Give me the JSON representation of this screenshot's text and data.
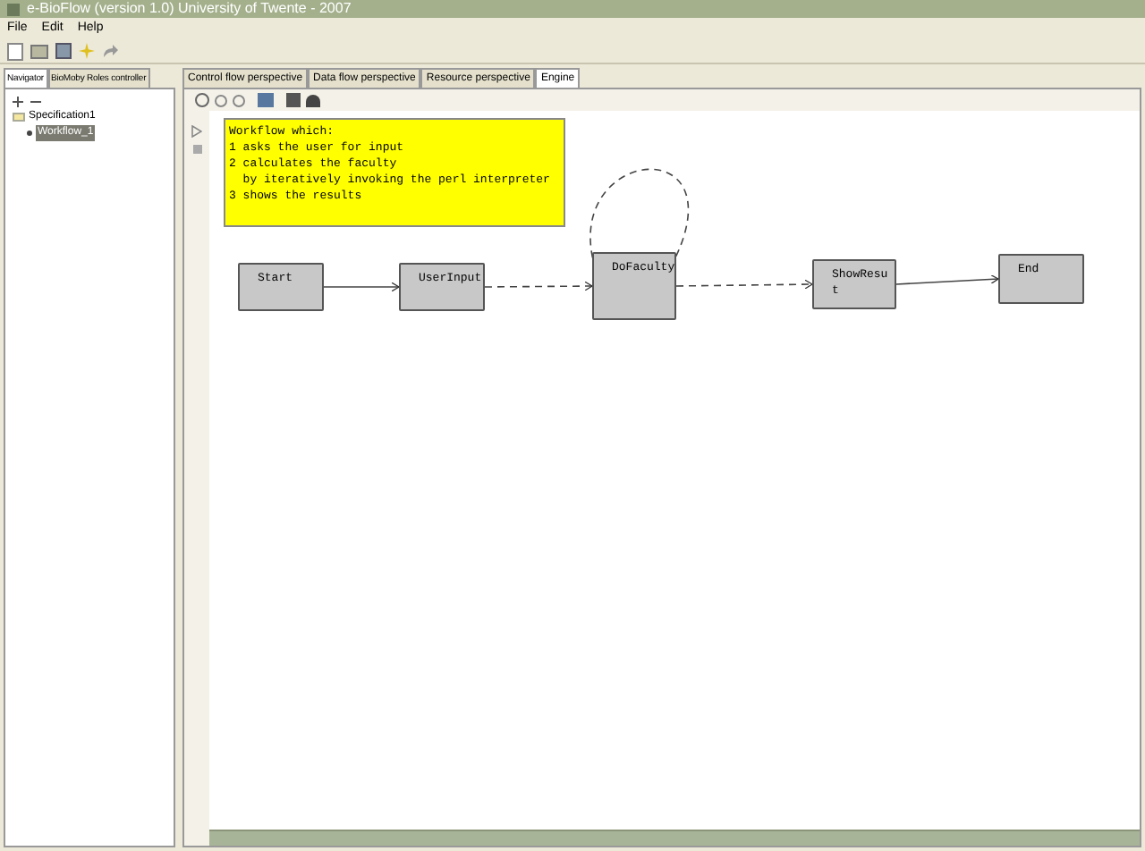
{
  "window": {
    "title": "e-BioFlow (version 1.0) University of Twente - 2007"
  },
  "menu": [
    "File",
    "Edit",
    "Help"
  ],
  "left_tabs": [
    {
      "label": "Navigator",
      "selected": true
    },
    {
      "label": "BioMoby Roles controller",
      "selected": false
    }
  ],
  "tree": [
    {
      "label": "Specification1",
      "expanded": true,
      "children": [
        {
          "label": "Workflow_1",
          "selected": true
        }
      ]
    }
  ],
  "tabs": [
    {
      "label": "Control flow perspective",
      "selected": false
    },
    {
      "label": "Data flow perspective",
      "selected": false
    },
    {
      "label": "Resource perspective",
      "selected": false
    },
    {
      "label": "Engine",
      "selected": true
    }
  ],
  "note": {
    "lines": [
      "Workflow which:",
      "1 asks the user for input",
      "2 calculates the faculty",
      "  by iteratively invoking the perl interpreter",
      "3 shows the results"
    ],
    "selected": true
  },
  "nodes": [
    {
      "label": "Start"
    },
    {
      "label": "UserInput"
    },
    {
      "label": "DoFaculty"
    },
    {
      "label": "ShowResu\nt"
    },
    {
      "label": "End"
    }
  ]
}
